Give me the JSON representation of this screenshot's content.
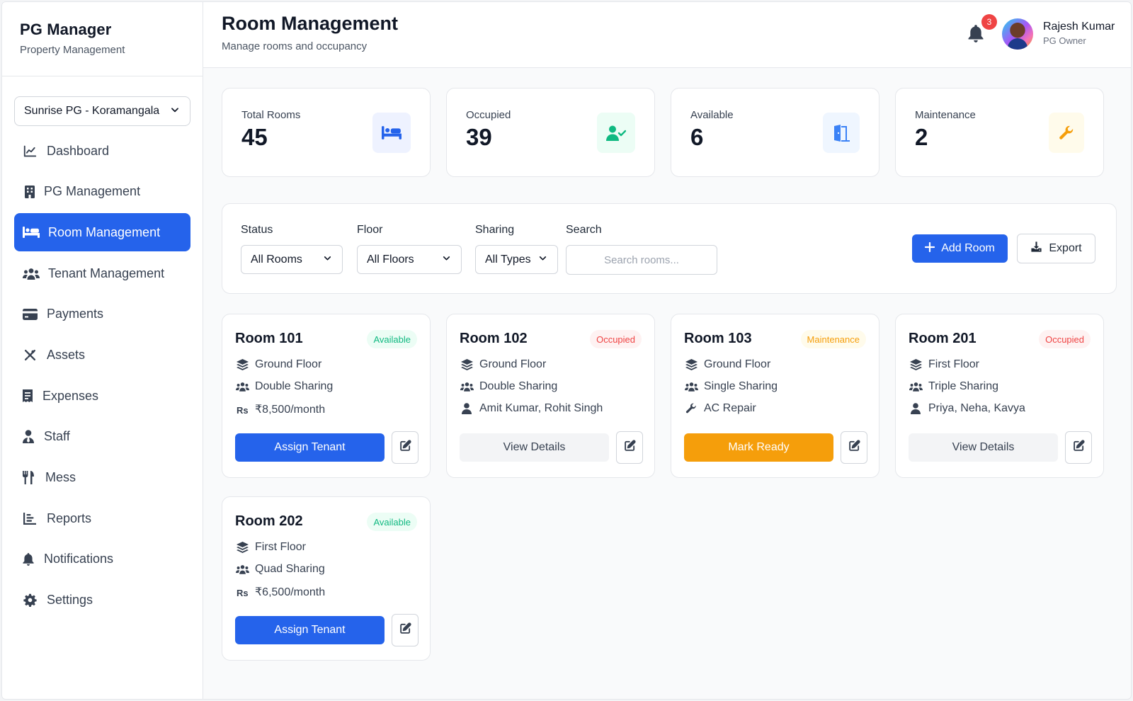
{
  "brand": {
    "title": "PG Manager",
    "subtitle": "Property Management"
  },
  "property_selector": {
    "value": "Sunrise PG - Koramangala",
    "icon": "chevron-down-icon"
  },
  "sidebar": {
    "items": [
      {
        "label": "Dashboard",
        "icon": "chart-line-icon"
      },
      {
        "label": "PG Management",
        "icon": "building-icon"
      },
      {
        "label": "Room Management",
        "icon": "bed-icon",
        "active": true
      },
      {
        "label": "Tenant Management",
        "icon": "users-icon"
      },
      {
        "label": "Payments",
        "icon": "credit-card-icon"
      },
      {
        "label": "Assets",
        "icon": "tools-icon"
      },
      {
        "label": "Expenses",
        "icon": "receipt-icon"
      },
      {
        "label": "Staff",
        "icon": "user-tie-icon"
      },
      {
        "label": "Mess",
        "icon": "utensils-icon"
      },
      {
        "label": "Reports",
        "icon": "chart-bar-icon"
      },
      {
        "label": "Notifications",
        "icon": "bell-icon"
      },
      {
        "label": "Settings",
        "icon": "gear-icon"
      }
    ]
  },
  "header": {
    "title": "Room Management",
    "subtitle": "Manage rooms and occupancy",
    "notification_count": "3",
    "user": {
      "name": "Rajesh Kumar",
      "role": "PG Owner"
    }
  },
  "stats": [
    {
      "label": "Total Rooms",
      "value": "45",
      "icon": "bed-icon",
      "icon_bg": "#eef2ff",
      "icon_color": "#2563eb"
    },
    {
      "label": "Occupied",
      "value": "39",
      "icon": "user-check-icon",
      "icon_bg": "#ecfdf5",
      "icon_color": "#10b981"
    },
    {
      "label": "Available",
      "value": "6",
      "icon": "door-open-icon",
      "icon_bg": "#eff6ff",
      "icon_color": "#3b82f6"
    },
    {
      "label": "Maintenance",
      "value": "2",
      "icon": "wrench-icon",
      "icon_bg": "#fffbeb",
      "icon_color": "#f59e0b"
    }
  ],
  "filters": {
    "status": {
      "label": "Status",
      "value": "All Rooms"
    },
    "floor": {
      "label": "Floor",
      "value": "All Floors"
    },
    "sharing": {
      "label": "Sharing",
      "value": "All Types"
    },
    "search": {
      "label": "Search",
      "placeholder": "Search rooms..."
    },
    "add_label": "Add Room",
    "export_label": "Export"
  },
  "rooms": [
    {
      "name": "Room 101",
      "status": "Available",
      "floor": "Ground Floor",
      "sharing": "Double Sharing",
      "info": "₹8,500/month",
      "info_icon": "rupee-icon",
      "action": "Assign Tenant"
    },
    {
      "name": "Room 102",
      "status": "Occupied",
      "floor": "Ground Floor",
      "sharing": "Double Sharing",
      "info": "Amit Kumar, Rohit Singh",
      "info_icon": "user-icon",
      "action": "View Details"
    },
    {
      "name": "Room 103",
      "status": "Maintenance",
      "floor": "Ground Floor",
      "sharing": "Single Sharing",
      "info": "AC Repair",
      "info_icon": "wrench-icon",
      "action": "Mark Ready"
    },
    {
      "name": "Room 201",
      "status": "Occupied",
      "floor": "First Floor",
      "sharing": "Triple Sharing",
      "info": "Priya, Neha, Kavya",
      "info_icon": "user-icon",
      "action": "View Details"
    },
    {
      "name": "Room 202",
      "status": "Available",
      "floor": "First Floor",
      "sharing": "Quad Sharing",
      "info": "₹6,500/month",
      "info_icon": "rupee-icon",
      "action": "Assign Tenant"
    }
  ],
  "colors": {
    "primary": "#2563eb",
    "available": "#10b981",
    "occupied": "#ef4444",
    "maintenance": "#f59e0b"
  }
}
